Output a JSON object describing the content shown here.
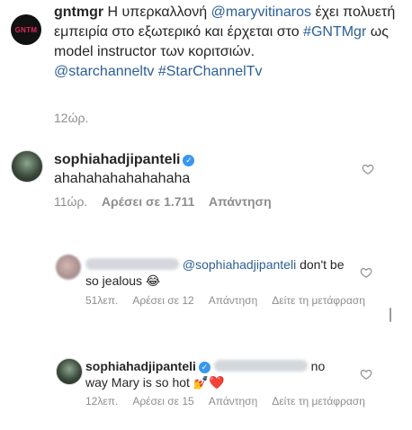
{
  "post": {
    "username": "gntmgr",
    "logo_text": "GNTM",
    "text_1": " Η υπερκαλλονή ",
    "mention": "@maryvitinaros",
    "text_2": " έχει πολυετή εμπειρία στο εξωτερικό και έρχεται στο ",
    "hashtag_1": "#GNTMgr",
    "text_3": " ως model instructor των κοριτσιών.",
    "mention_2": "@starchanneltv",
    "hashtag_2": "#StarChannelTv",
    "time": "12ώρ."
  },
  "comment": {
    "username": "sophiahadjipanteli",
    "text": "ahahahahahahahaha",
    "time": "11ώρ.",
    "likes": "Αρέσει σε 1.711",
    "reply": "Απάντηση"
  },
  "replies": [
    {
      "mention": "@sophiahadjipanteli",
      "text": " don't be so jealous 😂",
      "time": "51λεπ.",
      "likes": "Αρέσει σε 12",
      "reply": "Απάντηση",
      "translate": "Δείτε τη μετάφραση"
    },
    {
      "username": "sophiahadjipanteli",
      "text": " no way Mary is so hot 💅❤️",
      "time": "12λεπ.",
      "likes": "Αρέσει σε 15",
      "reply": "Απάντηση",
      "translate": "Δείτε τη μετάφραση"
    }
  ],
  "colors": {
    "link": "#2c5f94",
    "verified": "#3897f0",
    "meta": "#8e8e8e"
  },
  "icons": [
    "heart-outline-icon",
    "verified-badge-icon"
  ]
}
